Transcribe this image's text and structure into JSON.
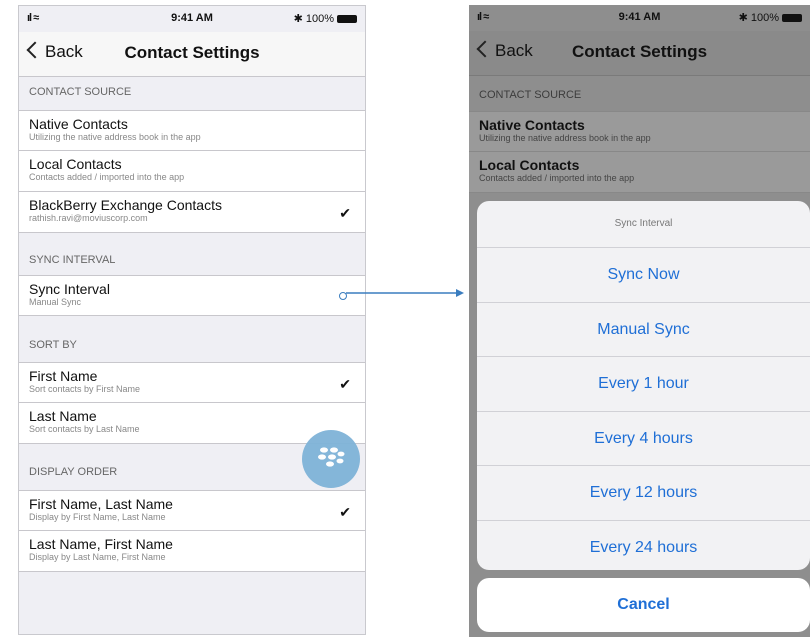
{
  "status": {
    "signal": "ııll",
    "wifi": "◆",
    "time": "9:41 AM",
    "battery": "✱ 100%"
  },
  "nav": {
    "back": "Back",
    "title": "Contact Settings"
  },
  "sections": {
    "contact_source": "CONTACT SOURCE",
    "sync_interval": "SYNC INTERVAL",
    "sort_by": "SORT BY",
    "display_order": "DISPLAY ORDER"
  },
  "rows": {
    "native": {
      "title": "Native Contacts",
      "sub": "Utilizing the native address book in the app"
    },
    "local": {
      "title": "Local Contacts",
      "sub": "Contacts added / imported into the app"
    },
    "blackberry": {
      "title": "BlackBerry Exchange Contacts",
      "sub": "rathish.ravi@moviuscorp.com",
      "checked": true
    },
    "sync": {
      "title": "Sync Interval",
      "sub": "Manual Sync"
    },
    "first_name": {
      "title": "First Name",
      "sub": "Sort contacts by First Name",
      "checked": true
    },
    "last_name": {
      "title": "Last Name",
      "sub": "Sort contacts by Last Name"
    },
    "first_last": {
      "title": "First Name, Last Name",
      "sub": "Display by First Name, Last Name",
      "checked": true
    },
    "last_first": {
      "title": "Last Name, First Name",
      "sub": "Display by Last Name, First Name"
    }
  },
  "checkmark": "✔",
  "action_sheet": {
    "title": "Sync Interval",
    "options": [
      "Sync Now",
      "Manual Sync",
      "Every 1 hour",
      "Every 4 hours",
      "Every 12 hours",
      "Every 24 hours"
    ],
    "cancel": "Cancel"
  },
  "colors": {
    "accent": "#1f6fd6",
    "connector": "#3a7dbf",
    "bb_button": "#7fb3d8"
  },
  "icons": {
    "back": "chevron-left-icon",
    "blackberry": "blackberry-logo-icon",
    "check": "checkmark-icon"
  }
}
